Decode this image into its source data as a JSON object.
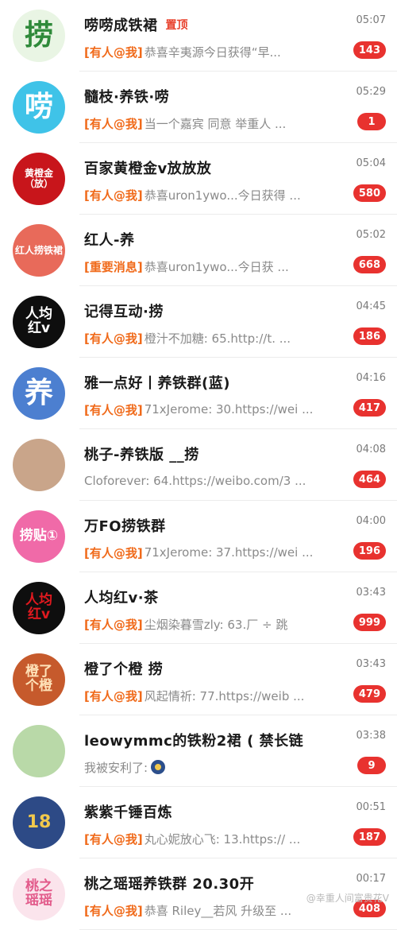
{
  "chats": [
    {
      "title": "唠唠成铁裙",
      "pin_label": "置顶",
      "time": "05:07",
      "tag": "[有人@我]",
      "preview": "恭喜辛夷源今日获得“早...",
      "badge": "143",
      "avatar": {
        "text": "捞",
        "bg": "#e9f5e4",
        "fg": "#2f8a3a"
      }
    },
    {
      "title": "髓枝·养铁·唠",
      "time": "05:29",
      "tag": "[有人@我]",
      "preview": "当一个嘉宾 同意 举重人 ...",
      "badge": "1",
      "avatar": {
        "text": "唠",
        "bg": "#3fc3e8",
        "fg": "#ffffff"
      }
    },
    {
      "title": "百家黄橙金v放放放",
      "time": "05:04",
      "tag": "[有人@我]",
      "preview": "恭喜uron1ywo...今日获得 ...",
      "badge": "580",
      "avatar": {
        "text": "黄橙金（放）",
        "bg": "#c8151b",
        "fg": "#ffffff"
      }
    },
    {
      "title": "红人-养",
      "time": "05:02",
      "tag": "[重要消息]",
      "preview": "恭喜uron1ywo...今日获 ...",
      "badge": "668",
      "avatar": {
        "text": "红人捞铁裙",
        "bg": "#e86a5a",
        "fg": "#ffffff"
      }
    },
    {
      "title": "记得互动·捞",
      "time": "04:45",
      "tag": "[有人@我]",
      "preview": "橙汁不加糖: 65.http://t. ...",
      "badge": "186",
      "avatar": {
        "text": "人均红v",
        "bg": "#0e0e0e",
        "fg": "#ffffff"
      }
    },
    {
      "title": "雅一点好丨养铁群(蓝)",
      "time": "04:16",
      "tag": "[有人@我]",
      "preview": "71xJerome: 30.https://wei ...",
      "badge": "417",
      "avatar": {
        "text": "养",
        "bg": "#4c7fd0",
        "fg": "#ffffff"
      }
    },
    {
      "title": "桃子-养铁版 __捞",
      "time": "04:08",
      "tag": "",
      "preview": "Cloforever: 64.https://weibo.com/3 ...",
      "badge": "464",
      "avatar": {
        "text": "",
        "bg": "#c9a58a",
        "fg": "#ffffff"
      }
    },
    {
      "title": "万FO捞铁群",
      "time": "04:00",
      "tag": "[有人@我]",
      "preview": "71xJerome: 37.https://wei ...",
      "badge": "196",
      "avatar": {
        "text": "捞贴①",
        "bg": "#f06aa8",
        "fg": "#ffffff"
      }
    },
    {
      "title": "人均红v·茶",
      "time": "03:43",
      "tag": "[有人@我]",
      "preview": "尘烟染暮雪zly: 63.厂 ÷ 跳",
      "badge": "999",
      "avatar": {
        "text": "人均红v",
        "bg": "#0e0e0e",
        "fg": "#e0191f"
      }
    },
    {
      "title": "橙了个橙   捞",
      "time": "03:43",
      "tag": "[有人@我]",
      "preview": "风起情祈: 77.https://weib ...",
      "badge": "479",
      "avatar": {
        "text": "橙了个橙",
        "bg": "#c65a2c",
        "fg": "#ffe2b8"
      }
    },
    {
      "title": "leowymmc的铁粉2裙 ( 禁长链 )",
      "time": "03:38",
      "tag": "",
      "preview": "我被安利了:",
      "badge": "9",
      "has_emoji": true,
      "avatar": {
        "text": "",
        "bg": "#b9d9a8",
        "fg": "#ffffff"
      }
    },
    {
      "title": "紫紫千锤百炼",
      "time": "00:51",
      "tag": "[有人@我]",
      "preview": "丸心妮放心飞: 13.https:// ...",
      "badge": "187",
      "avatar": {
        "text": "18",
        "bg": "#2d4a86",
        "fg": "#f2c94c"
      }
    },
    {
      "title": "桃之瑶瑶养铁群 20.30开",
      "time": "00:17",
      "tag": "[有人@我]",
      "preview": "恭喜 Riley__若风 升级至 ...",
      "badge": "408",
      "avatar": {
        "text": "桃之瑶瑶",
        "bg": "#fbe4ec",
        "fg": "#e25a8a"
      }
    }
  ],
  "watermark": "@幸重人间富贵花V"
}
